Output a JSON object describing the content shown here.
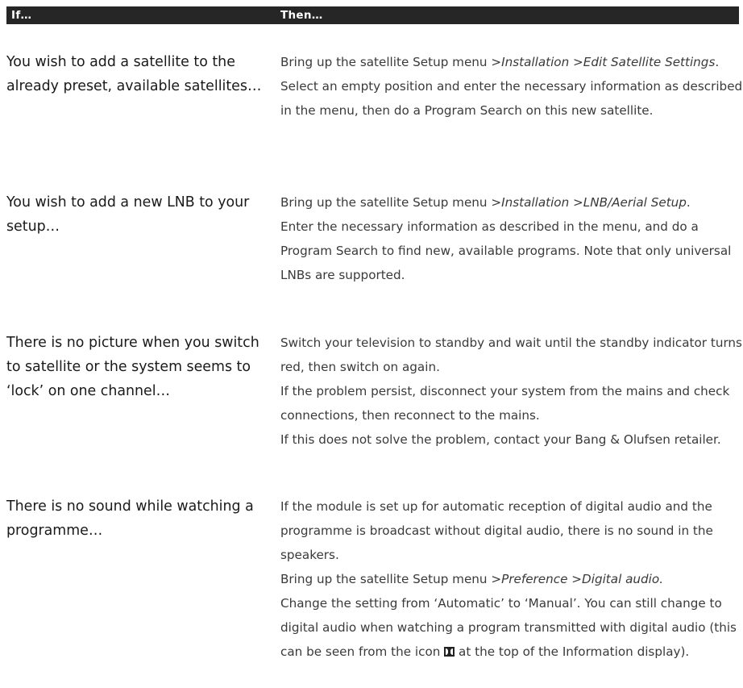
{
  "table": {
    "header": {
      "if_label": "If…",
      "then_label": "Then…"
    },
    "rows": [
      {
        "if": "You wish to add a satellite to the already preset, available satellites…",
        "then": [
          {
            "parts": [
              "Bring up the satellite Setup menu >",
              "Installation",
              " >",
              "Edit Satellite Settings",
              "."
            ]
          },
          {
            "parts": [
              "Select an empty position and enter the necessary information as described in the menu, then do a Program Search on this new satellite."
            ]
          }
        ]
      },
      {
        "if": "You wish to add a new LNB to your setup…",
        "then": [
          {
            "parts": [
              "Bring up the satellite Setup menu >",
              "Installation",
              " >",
              "LNB/Aerial Setup",
              "."
            ]
          },
          {
            "parts": [
              "Enter the necessary information as described in the menu, and do a Program Search to find new, available programs. Note that only universal LNBs are supported."
            ]
          }
        ]
      },
      {
        "if": "There is no picture when you switch to satellite or the system seems to ‘lock’ on one channel…",
        "then": [
          {
            "parts": [
              "Switch your television to standby and wait until the standby indicator turns red, then switch on again."
            ]
          },
          {
            "parts": [
              "If the problem persist, disconnect your system from the mains and check connections, then reconnect to the mains."
            ]
          },
          {
            "parts": [
              "If this does not solve the problem, contact your Bang & Olufsen retailer."
            ]
          }
        ]
      },
      {
        "if": "There is no sound while watching a programme…",
        "then": [
          {
            "parts": [
              "If the module is set up for automatic reception of digital audio and the programme is broadcast without digital audio, there is no sound in the speakers."
            ]
          },
          {
            "parts": [
              "Bring up the satellite Setup menu >",
              "Preference",
              " >",
              "Digital audio."
            ]
          },
          {
            "parts": [
              "Change the setting from ‘Automatic’ to ‘Manual’. You can still change to digital audio when watching a program transmitted with digital audio (this can be seen from the icon ",
              " at the top of the Information display)."
            ]
          }
        ]
      }
    ]
  }
}
